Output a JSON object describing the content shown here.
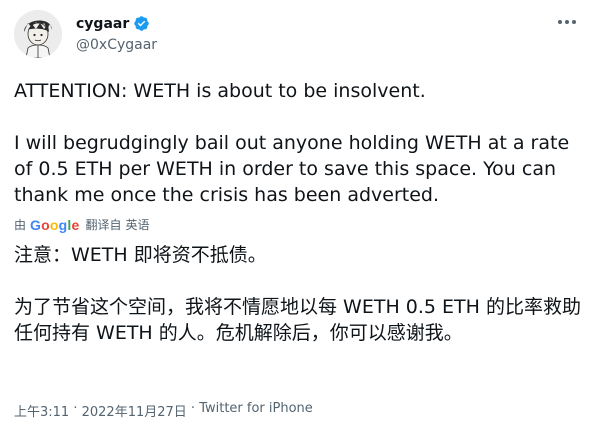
{
  "author": {
    "display_name": "cygaar",
    "handle": "@0xCygaar"
  },
  "tweet": {
    "text": "ATTENTION: WETH is about to be insolvent.\n\nI will begrudgingly bail out anyone holding WETH at a rate of 0.5 ETH per WETH in order to save this space. You can thank me once the crisis has been adverted.",
    "translation_by": "由",
    "translation_provider": "Google",
    "translation_action": "翻译自",
    "source_language": "英语",
    "translated_text": "注意：WETH 即将资不抵债。\n\n为了节省这个空间，我将不情愿地以每 WETH 0.5 ETH 的比率救助任何持有 WETH 的人。危机解除后，你可以感谢我。",
    "time": "上午3:11",
    "separator": " · ",
    "date": "2022年11月27日",
    "source_app": "Twitter for iPhone"
  },
  "colors": {
    "verified_blue": "#1d9bf0",
    "secondary_text": "#536471",
    "google_blue": "#4285f4",
    "google_red": "#ea4335",
    "google_yellow": "#fbbc05",
    "google_green": "#34a853"
  },
  "icons": {
    "verified": "verified-badge-icon",
    "more": "more-options-icon"
  }
}
